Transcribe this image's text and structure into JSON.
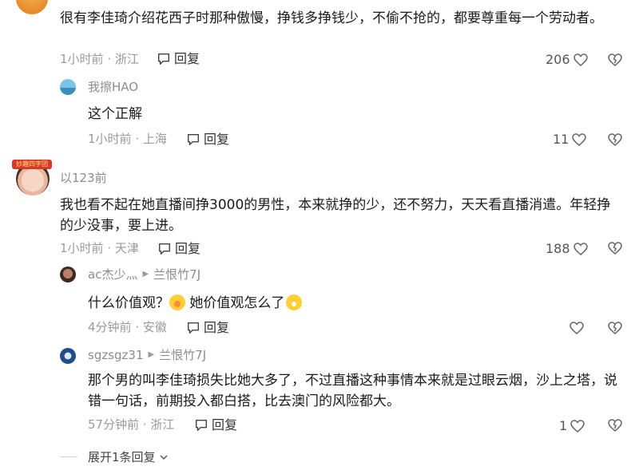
{
  "comments": [
    {
      "id": "c1",
      "text": "很有李佳琦介绍花西子时那种傲慢，挣钱多挣钱少，不偷不抢的，都要尊重每一个劳动者。",
      "time_location": "1小时前 · 浙江",
      "reply_label": "回复",
      "likes": "206"
    },
    {
      "id": "r1",
      "author": "我擦HAO",
      "text": "这个正解",
      "time_location": "1小时前 · 上海",
      "reply_label": "回复",
      "likes": "11"
    },
    {
      "id": "c2",
      "author": "以123前",
      "avatar_badge": "妙趣四字团",
      "text": "我也看不起在她直播间挣3000的男性，本来就挣的少，还不努力，天天看直播消遣。年轻挣的少没事，要上进。",
      "time_location": "1小时前 · 天津",
      "reply_label": "回复",
      "likes": "188"
    },
    {
      "id": "r2",
      "author": "ac杰少灬",
      "reply_to": "兰恨竹7J",
      "text_part1": "什么价值观？",
      "text_part2": " 她价值观怎么了",
      "time_location": "4分钟前 · 安徽",
      "reply_label": "回复",
      "likes": ""
    },
    {
      "id": "r3",
      "author": "sgzsgz31",
      "reply_to": "兰恨竹7J",
      "text": "那个男的叫李佳琦损失比她大多了，不过直播这种事情本来就是过眼云烟，沙上之塔，说错一句话，前期投入都白搭，比去澳门的风险都大。",
      "time_location": "57分钟前 · 浙江",
      "reply_label": "回复",
      "likes": "1"
    }
  ],
  "expand_replies": "展开1条回复",
  "icons": {
    "reply": "comment-bubble-icon",
    "like": "heart-icon",
    "dislike": "broken-heart-icon",
    "reply_arrow": "triangle-right-icon",
    "expand": "chevron-down-icon"
  },
  "colors": {
    "meta": "#9a9a9a",
    "text": "#1a1a1a",
    "author": "#8c8c8c"
  }
}
